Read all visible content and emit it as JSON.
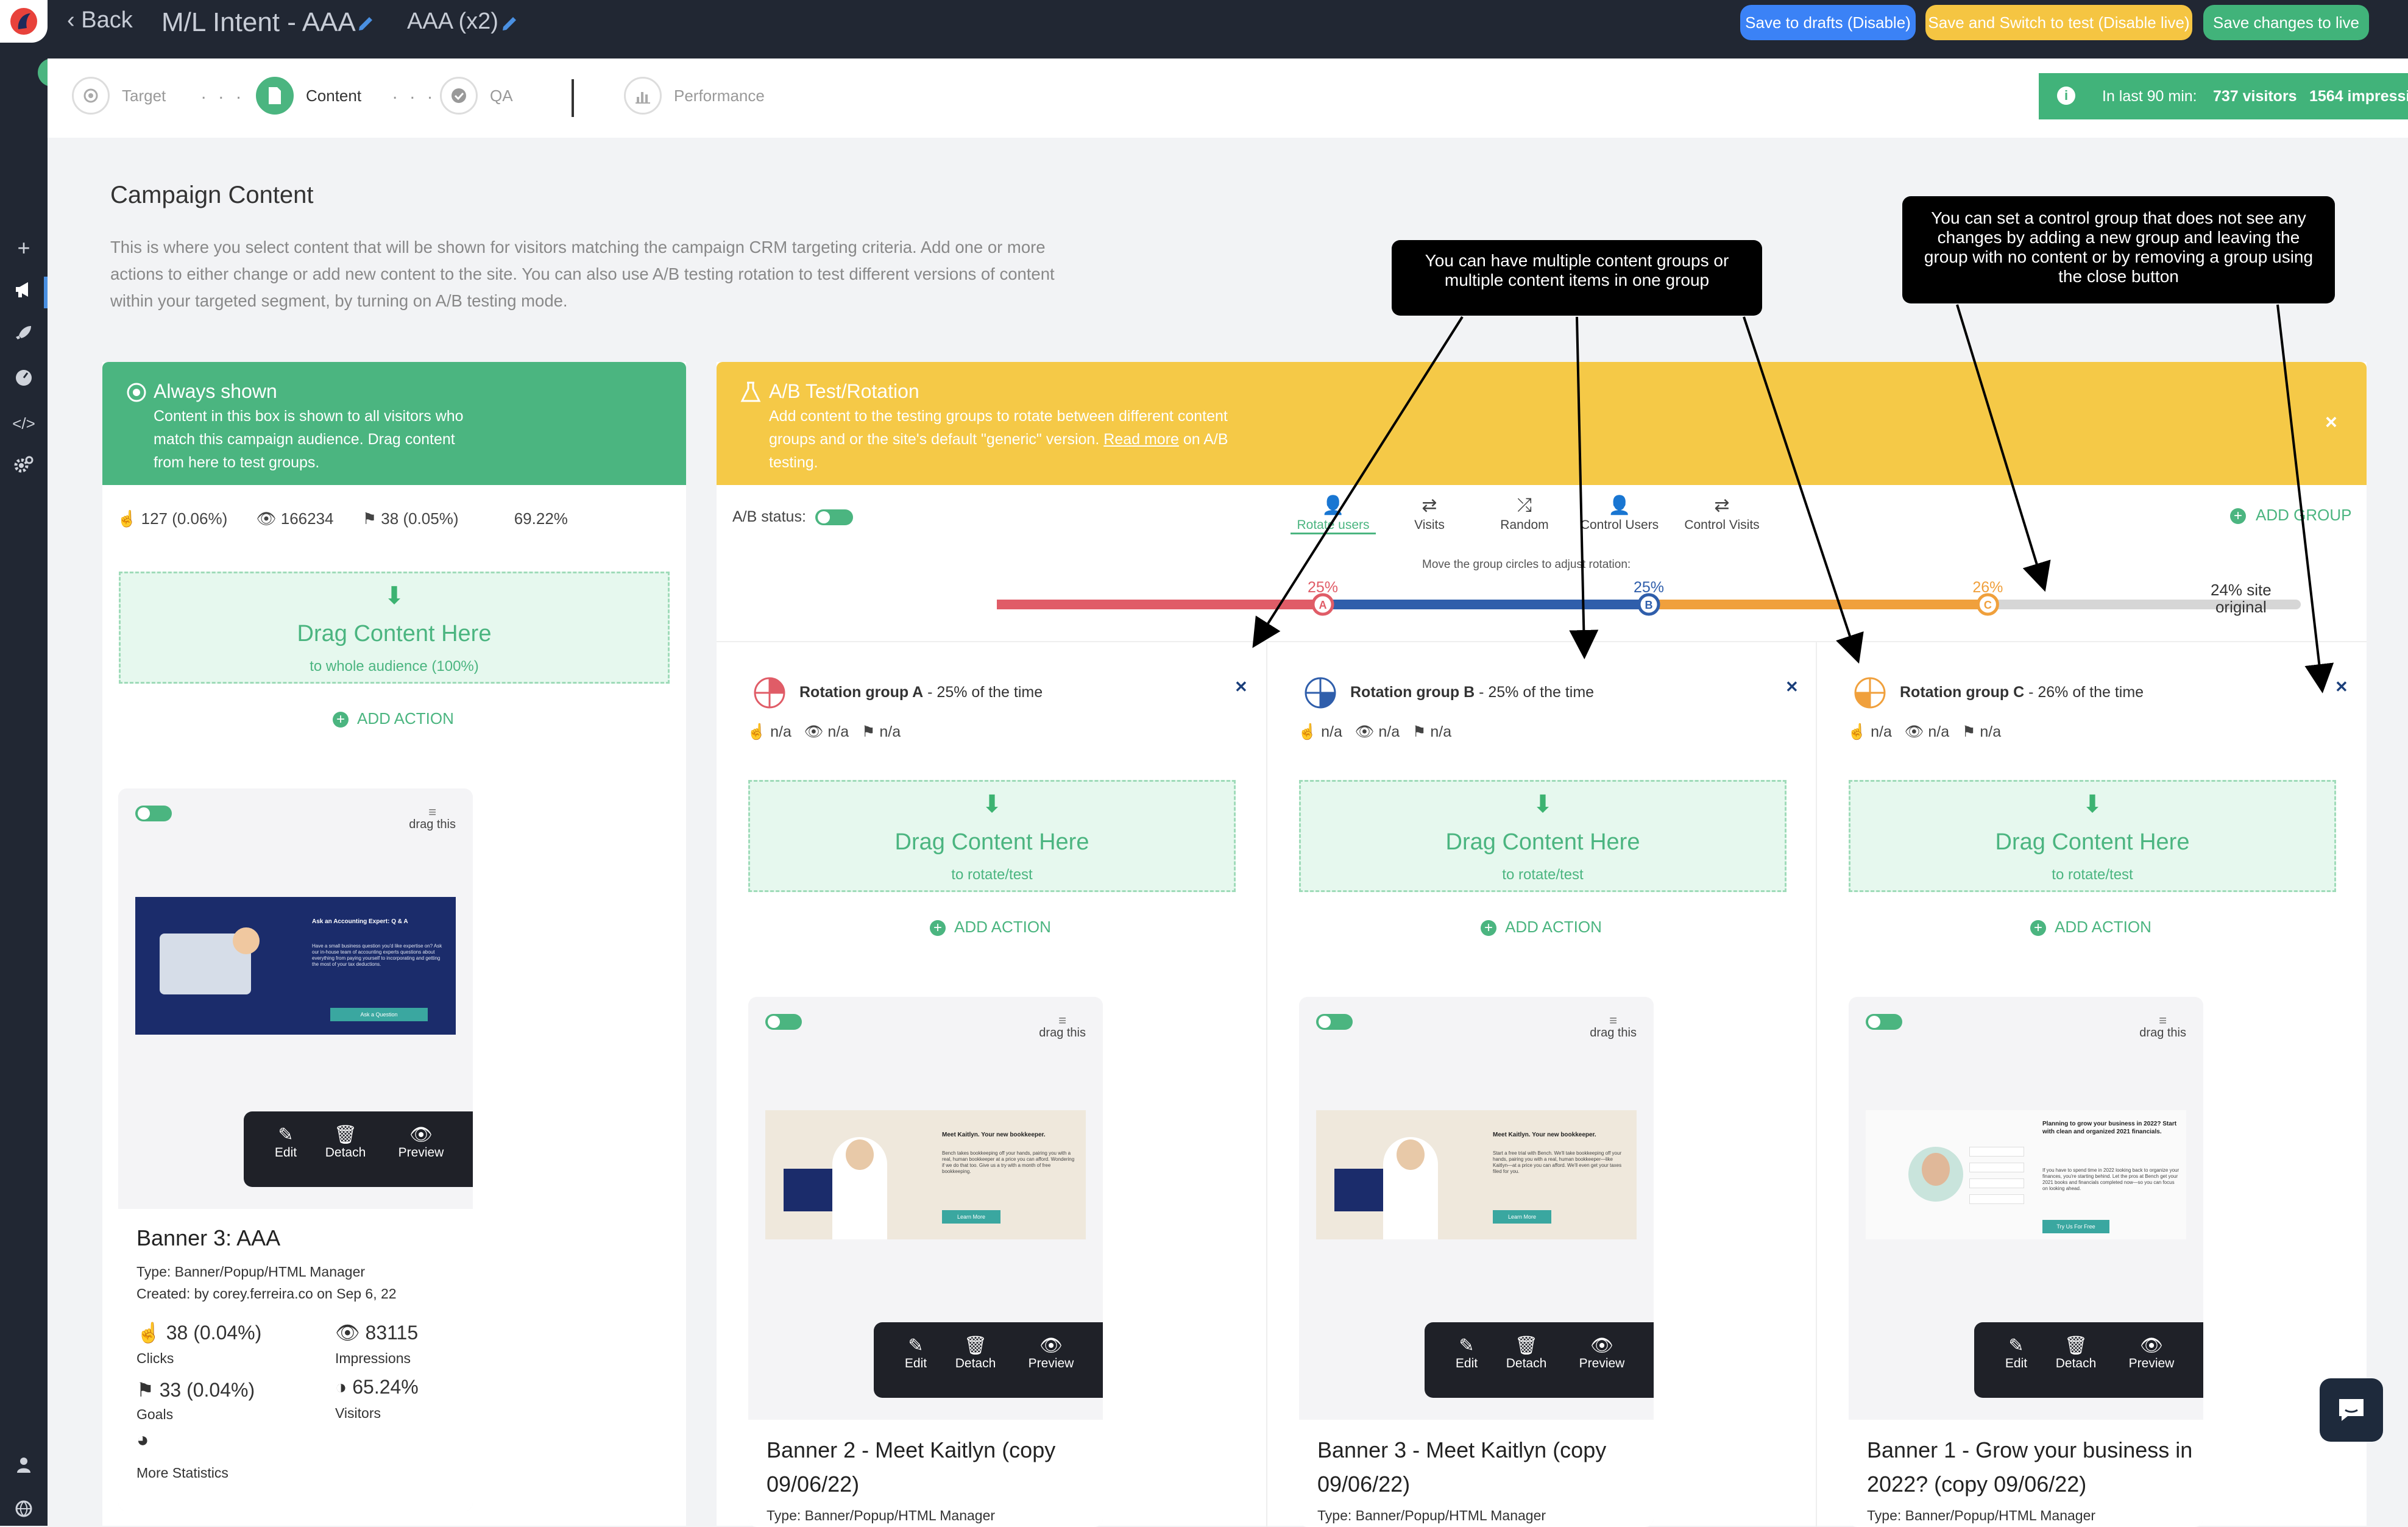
{
  "topbar": {
    "back_label": "Back",
    "campaign_title": "M/L Intent - AAA",
    "variant_label": "AAA (x2)",
    "buttons": [
      {
        "label": "Save to drafts (Disable)",
        "color": "#3b82f6"
      },
      {
        "label": "Save and Switch to test (Disable live)",
        "color": "#f5c542"
      },
      {
        "label": "Save changes to live",
        "color": "#41b37a"
      }
    ]
  },
  "sidebar": {
    "icons": [
      "plus-icon",
      "megaphone-icon",
      "rocket-icon",
      "dashboard-icon",
      "code-icon",
      "gears-icon",
      "user-icon",
      "globe-icon"
    ]
  },
  "stepper": {
    "steps": [
      {
        "label": "Target"
      },
      {
        "label": "Content"
      },
      {
        "label": "QA"
      },
      {
        "label": "Performance"
      }
    ],
    "dots": ". . ."
  },
  "visitors": {
    "prefix": "In last 90 min:",
    "visitors": "737 visitors",
    "impressions": "1564 impressions"
  },
  "content_section": {
    "title": "Campaign Content",
    "description": "This is where you select content that will be shown for visitors matching the campaign CRM targeting criteria. Add one or more actions to either change or add new content to the site. You can also use A/B testing rotation to test different versions of content within your targeted segment, by turning on A/B testing mode."
  },
  "callouts": {
    "multiple_groups": "You can have multiple content groups or multiple content items in one group",
    "control_group": "You can set a control group that does not see any changes by adding a new group and leaving the group with no content or by removing a group using the close button"
  },
  "always_shown": {
    "title": "Always shown",
    "text": "Content in this box is shown to all visitors who match this campaign audience. Drag content from here to test groups.",
    "stats": {
      "clicks": "127 (0.06%)",
      "views": "166234",
      "goals": "38 (0.05%)",
      "percent": "69.22%"
    },
    "drop": {
      "title": "Drag Content Here",
      "subtitle": "to whole audience (100%)"
    },
    "add_action": "ADD ACTION",
    "card": {
      "drag_label": "drag this",
      "banner_heading": "Ask an Accounting Expert: Q & A",
      "banner_body": "Have a small business question you'd like expertise on? Ask our in-house team of accounting experts questions about everything from paying yourself to incorporating and getting the most of your tax deductions.",
      "banner_button": "Ask a Question",
      "tools": [
        "Edit",
        "Detach",
        "Preview"
      ],
      "name": "Banner 3: AAA",
      "type": "Type: Banner/Popup/HTML Manager",
      "created": "Created: by corey.ferreira.co on Sep 6, 22",
      "clicks_value": "38 (0.04%)",
      "clicks_label": "Clicks",
      "impressions_value": "83115",
      "impressions_label": "Impressions",
      "goals_value": "33 (0.04%)",
      "goals_label": "Goals",
      "visitors_value": "65.24%",
      "visitors_label": "Visitors",
      "more": "More Statistics"
    }
  },
  "ab_test": {
    "title": "A/B Test/Rotation",
    "text_before_link": "Add content to the testing groups to rotate between different content groups and or the site's default \"generic\" version.",
    "link": "Read more",
    "text_after_link": "on A/B testing.",
    "close": "×",
    "status_label": "A/B status:",
    "modes": [
      {
        "label": "Rotate users",
        "icon": "user-icon"
      },
      {
        "label": "Visits",
        "icon": "swap-icon"
      },
      {
        "label": "Random",
        "icon": "shuffle-icon"
      },
      {
        "label": "Control Users",
        "icon": "user-icon"
      },
      {
        "label": "Control Visits",
        "icon": "swap-icon"
      }
    ],
    "add_group": "ADD GROUP",
    "slider_hint": "Move the group circles to adjust rotation:",
    "rotation": [
      {
        "letter": "A",
        "percent": "25%",
        "share": 25,
        "color": "#e05c67"
      },
      {
        "letter": "B",
        "percent": "25%",
        "share": 25,
        "color": "#2f5eab"
      },
      {
        "letter": "C",
        "percent": "26%",
        "share": 26,
        "color": "#f0a03c"
      }
    ],
    "original_line1": "24% site",
    "original_line2": "original",
    "original_share": 24,
    "groups": [
      {
        "title": "Rotation group A",
        "suffix": "- 25% of the time",
        "color": "#e05c67",
        "stats": {
          "clicks": "n/a",
          "views": "n/a",
          "goals": "n/a"
        },
        "drop": {
          "title": "Drag Content Here",
          "subtitle": "to rotate/test"
        },
        "add_action": "ADD ACTION",
        "card": {
          "drag_label": "drag this",
          "banner_heading": "Meet Kaitlyn. Your new bookkeeper.",
          "banner_body": "Bench takes bookkeeping off your hands, pairing you with a real, human bookkeeper at a price you can afford. Wondering if we do that too. Give us a try with a month of free bookkeeping.",
          "banner_button": "Learn More",
          "tools": [
            "Edit",
            "Detach",
            "Preview"
          ],
          "name": "Banner 2 - Meet Kaitlyn (copy 09/06/22)",
          "type": "Type: Banner/Popup/HTML Manager"
        }
      },
      {
        "title": "Rotation group B",
        "suffix": "- 25% of the time",
        "color": "#2f5eab",
        "stats": {
          "clicks": "n/a",
          "views": "n/a",
          "goals": "n/a"
        },
        "drop": {
          "title": "Drag Content Here",
          "subtitle": "to rotate/test"
        },
        "add_action": "ADD ACTION",
        "card": {
          "drag_label": "drag this",
          "banner_heading": "Meet Kaitlyn. Your new bookkeeper.",
          "banner_body": "Start a free trial with Bench. We'll take bookkeeping off your hands, pairing you with a real, human bookkeeper—like Kaitlyn—at a price you can afford. We'll even get your taxes filed for you.",
          "banner_button": "Learn More",
          "tools": [
            "Edit",
            "Detach",
            "Preview"
          ],
          "name": "Banner 3 - Meet Kaitlyn (copy 09/06/22)",
          "type": "Type: Banner/Popup/HTML Manager"
        }
      },
      {
        "title": "Rotation group C",
        "suffix": "- 26% of the time",
        "color": "#f0a03c",
        "stats": {
          "clicks": "n/a",
          "views": "n/a",
          "goals": "n/a"
        },
        "drop": {
          "title": "Drag Content Here",
          "subtitle": "to rotate/test"
        },
        "add_action": "ADD ACTION",
        "card": {
          "drag_label": "drag this",
          "banner_heading": "Planning to grow your business in 2022? Start with clean and organized 2021 financials.",
          "banner_body": "If you have to spend time in 2022 looking back to organize your finances, you're starting behind. Let the pros at Bench get your 2021 books and financials completed now—so you can focus on looking ahead.",
          "banner_button": "Try Us For Free",
          "tools": [
            "Edit",
            "Detach",
            "Preview"
          ],
          "name": "Banner 1 - Grow your business in 2022? (copy 09/06/22)",
          "type": "Type: Banner/Popup/HTML Manager"
        }
      }
    ]
  },
  "colors": {
    "green": "#41b37a",
    "yellow": "#f5c947",
    "dark": "#212733",
    "blue": "#3b82f6"
  }
}
